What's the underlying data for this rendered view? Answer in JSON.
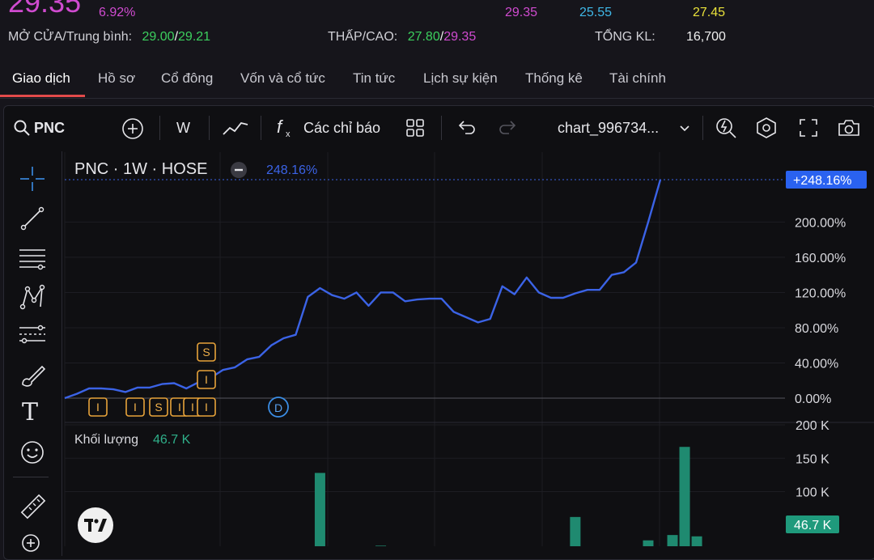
{
  "header": {
    "price": "29.35",
    "change_pct": "6.92%",
    "quote_values": [
      "29.35",
      "25.55",
      "27.45"
    ],
    "open_avg_label": "MỞ CỬA/Trung bình:",
    "open_value": "29.00",
    "avg_value": "29.21",
    "slash": "/",
    "lowhigh_label": "THẤP/CAO:",
    "low_value": "27.80",
    "high_value": "29.35",
    "volume_label": "TỔNG KL:",
    "volume_value": "16,700"
  },
  "tabs": [
    "Giao dịch",
    "Hồ sơ",
    "Cổ đông",
    "Vốn và cổ tức",
    "Tin tức",
    "Lịch sự kiện",
    "Thống kê",
    "Tài chính"
  ],
  "toolbar": {
    "symbol": "PNC",
    "interval": "W",
    "indicators_label": "Các chỉ báo",
    "chart_name": "chart_996734..."
  },
  "legend": {
    "title": "PNC · 1W · HOSE",
    "value": "248.16%",
    "volume_label": "Khối lượng",
    "volume_value": "46.7 K"
  },
  "colors": {
    "line": "#3b63e6",
    "vol_up": "#1f8a70",
    "vol_down": "#b03a3a",
    "marker": "#e8a33a",
    "dividend": "#3b8ee6"
  },
  "chart_data": {
    "type": "line",
    "series": [
      {
        "values": [
          0,
          5,
          11,
          11,
          10,
          7,
          12,
          12,
          16,
          17,
          11,
          18,
          23,
          32,
          35,
          44,
          47,
          60,
          68,
          72,
          115,
          125,
          117,
          113,
          120,
          105,
          120,
          120,
          110,
          112,
          113,
          113,
          98,
          92,
          86,
          90,
          127,
          118,
          137,
          120,
          114,
          114,
          119,
          123,
          123,
          140,
          143,
          154,
          200,
          248.16
        ]
      }
    ],
    "y_ticks": [
      "248.16%",
      "200.00%",
      "160.00%",
      "120.00%",
      "80.00%",
      "40.00%",
      "0.00%"
    ],
    "ylim": [
      0,
      248.16
    ],
    "last_value_label": "+248.16%",
    "markers": [
      {
        "label": "I",
        "index": 2
      },
      {
        "label": "I",
        "index": 6
      },
      {
        "label": "S",
        "index": 8
      },
      {
        "label": "I",
        "index": 10
      },
      {
        "label": "I",
        "index": 11
      },
      {
        "label": "I",
        "index": 12
      },
      {
        "label": "I",
        "index": 12,
        "row": 2
      },
      {
        "label": "S",
        "index": 12,
        "row": 3
      }
    ],
    "dividend_marker": {
      "label": "D",
      "index": 18
    },
    "volume": {
      "y_ticks": [
        "200 K",
        "150 K",
        "100 K"
      ],
      "ylim": [
        0,
        200
      ],
      "last_value_label": "46.7 K",
      "bars": [
        {
          "index": 1,
          "value": 12,
          "dir": "down"
        },
        {
          "index": 19,
          "value": 15,
          "dir": "down"
        },
        {
          "index": 20,
          "value": 17,
          "dir": "up"
        },
        {
          "index": 21,
          "value": 128,
          "dir": "up"
        },
        {
          "index": 26,
          "value": 19,
          "dir": "up"
        },
        {
          "index": 40,
          "value": 4,
          "dir": "up"
        },
        {
          "index": 42,
          "value": 62,
          "dir": "up"
        },
        {
          "index": 48,
          "value": 27,
          "dir": "up"
        },
        {
          "index": 50,
          "value": 35,
          "dir": "up"
        },
        {
          "index": 51,
          "value": 167,
          "dir": "up"
        },
        {
          "index": 52,
          "value": 33,
          "dir": "up"
        }
      ]
    }
  }
}
